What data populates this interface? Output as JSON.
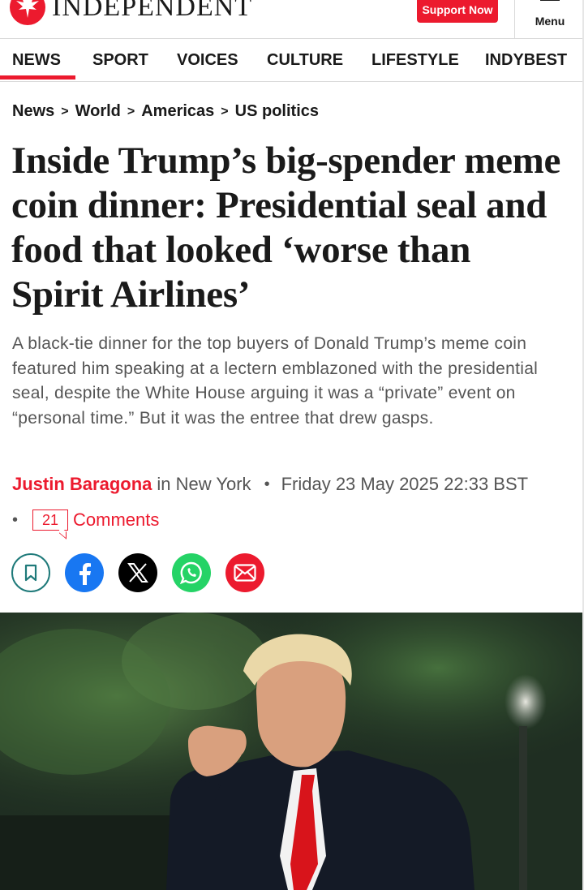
{
  "brand": {
    "name": "INDEPENDENT",
    "accent": "#ec1a2e",
    "logo_icon": "eagle-logo-icon"
  },
  "header": {
    "support_label": "Support Now",
    "menu_label": "Menu"
  },
  "nav": {
    "items": [
      {
        "label": "NEWS",
        "active": true
      },
      {
        "label": "SPORT"
      },
      {
        "label": "VOICES"
      },
      {
        "label": "CULTURE"
      },
      {
        "label": "LIFESTYLE"
      },
      {
        "label": "INDYBEST"
      }
    ]
  },
  "breadcrumb": {
    "items": [
      "News",
      "World",
      "Americas",
      "US politics"
    ],
    "separator": ">"
  },
  "article": {
    "headline": "Inside Trump’s big-spender meme coin dinner: Presidential seal and food that looked ‘worse than Spirit Airlines’",
    "standfirst": "A black-tie dinner for the top buyers of Donald Trump’s meme coin featured him speaking at a lectern emblazoned with the presidential seal, despite the White House arguing it was a “private” event on “personal time.” But it was the entree that drew gasps.",
    "author": "Justin Baragona",
    "location": "in New York",
    "byline_separator": "•",
    "date": "Friday 23 May 2025 22:33 BST",
    "comment_count": "21",
    "comments_label": "Comments"
  },
  "share": [
    {
      "icon": "bookmark-icon",
      "color": "#1f7a7a"
    },
    {
      "icon": "facebook-icon",
      "color": "#1877f2"
    },
    {
      "icon": "x-icon",
      "color": "#000000"
    },
    {
      "icon": "whatsapp-icon",
      "color": "#25d366"
    },
    {
      "icon": "email-icon",
      "color": "#ec1a2e"
    }
  ]
}
